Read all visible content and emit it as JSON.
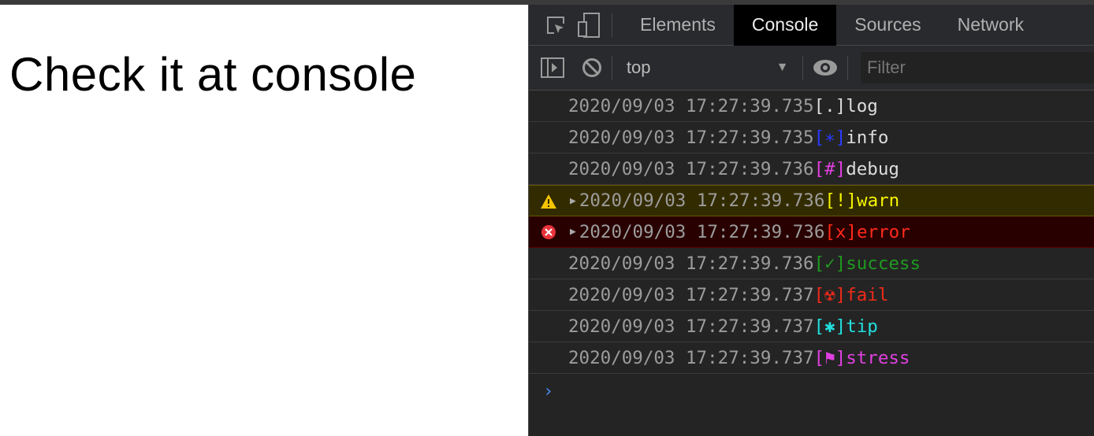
{
  "page": {
    "heading": "Check it at console"
  },
  "devtools": {
    "tabs": [
      {
        "label": "Elements"
      },
      {
        "label": "Console",
        "active": true
      },
      {
        "label": "Sources"
      },
      {
        "label": "Network"
      }
    ],
    "context": "top",
    "filter_placeholder": "Filter",
    "messages": [
      {
        "time": "2020/09/03 17:27:39.735",
        "tag": "[.]",
        "text": "log",
        "color": "#dcdcdc",
        "tag_color": "#dcdcdc",
        "level": "log"
      },
      {
        "time": "2020/09/03 17:27:39.735",
        "tag": "[∗]",
        "text": "info",
        "color": "#dcdcdc",
        "tag_color": "#2b3cff",
        "level": "info"
      },
      {
        "time": "2020/09/03 17:27:39.736",
        "tag": "[#]",
        "text": "debug",
        "color": "#dcdcdc",
        "tag_color": "#e040e0",
        "level": "debug"
      },
      {
        "time": "2020/09/03 17:27:39.736",
        "tag": "[!]",
        "text": "warn",
        "color": "#f5f500",
        "tag_color": "#f5f500",
        "level": "warn"
      },
      {
        "time": "2020/09/03 17:27:39.736",
        "tag": "[x]",
        "text": "error",
        "color": "#ff2a1a",
        "tag_color": "#ff2a1a",
        "level": "error"
      },
      {
        "time": "2020/09/03 17:27:39.736",
        "tag": "[✓]",
        "text": "success",
        "color": "#1f9a1f",
        "tag_color": "#1f9a1f",
        "level": "log"
      },
      {
        "time": "2020/09/03 17:27:39.737",
        "tag": "[☢]",
        "text": "fail",
        "color": "#ee2a1a",
        "tag_color": "#ee2a1a",
        "level": "log"
      },
      {
        "time": "2020/09/03 17:27:39.737",
        "tag": "[✱]",
        "text": "tip",
        "color": "#22dede",
        "tag_color": "#22dede",
        "level": "log"
      },
      {
        "time": "2020/09/03 17:27:39.737",
        "tag": "[⚑]",
        "text": "stress",
        "color": "#e040e0",
        "tag_color": "#e040e0",
        "level": "log"
      }
    ],
    "prompt": "›"
  }
}
